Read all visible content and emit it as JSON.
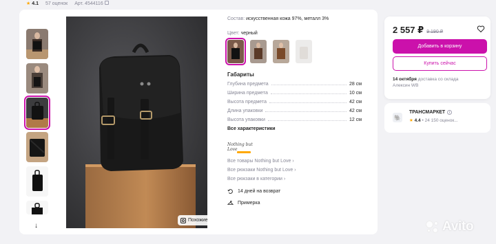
{
  "header": {
    "star": "★",
    "rating": "4.1",
    "reviews": "57 оценок",
    "article": "Арт. 4544116"
  },
  "gallery": {
    "thumbnails": [
      "thumb-1",
      "thumb-2",
      "thumb-3-active",
      "thumb-4",
      "thumb-5",
      "thumb-6"
    ],
    "similar_label": "Похожие"
  },
  "details": {
    "composition_label": "Состав:",
    "composition_value": "искусственная кожа 97%, металл 3%",
    "color_label": "Цвет:",
    "color_value": "черный",
    "specs_title": "Габариты",
    "specs": [
      {
        "label": "Глубина предмета",
        "value": "28 см"
      },
      {
        "label": "Ширина предмета",
        "value": "10 см"
      },
      {
        "label": "Высота предмета",
        "value": "42 см"
      },
      {
        "label": "Длина упаковки",
        "value": "42 см"
      },
      {
        "label": "Высота упаковки",
        "value": "12 см"
      }
    ],
    "all_specs": "Все характеристики",
    "brand_logo_text": "Nothing but Love",
    "brand_links": [
      "Все товары Nothing but Love",
      "Все рюкзаки Nothing but Love",
      "Все рюкзаки в категории"
    ],
    "features": [
      {
        "icon": "return-icon",
        "label": "14 дней на возврат"
      },
      {
        "icon": "hanger-icon",
        "label": "Примерка"
      }
    ]
  },
  "purchase": {
    "price": "2 557 ₽",
    "old_price": "9 190 ₽",
    "add_to_cart": "Добавить в корзину",
    "buy_now": "Купить сейчас",
    "delivery_date": "14 октября",
    "delivery_text": "доставка со склада",
    "warehouse": "Алексин WB"
  },
  "seller": {
    "name": "ТРАНСМАРКЕТ",
    "star": "★",
    "rating": "4.4",
    "reviews": "• 24 150 оценок..."
  },
  "watermark": "Avito",
  "colors": {
    "accent": "#cb11ab",
    "star": "#ffa800",
    "muted": "#868695"
  }
}
